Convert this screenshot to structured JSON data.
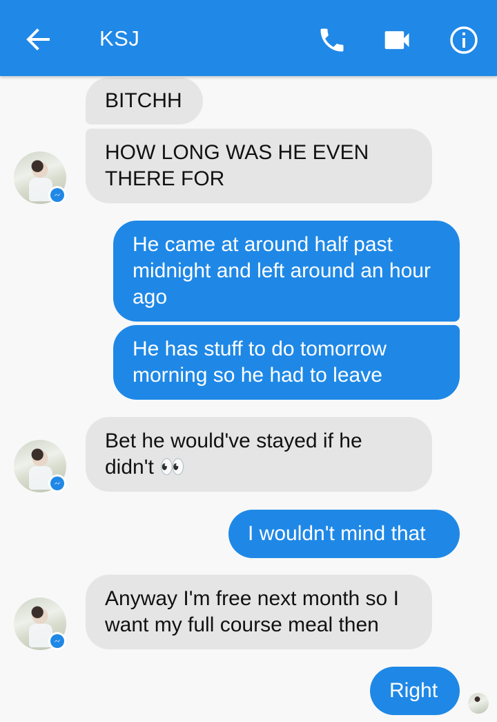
{
  "header": {
    "title": "KSJ"
  },
  "messages": [
    {
      "text": "BITCHH"
    },
    {
      "text": "HOW LONG WAS HE EVEN THERE FOR"
    },
    {
      "text": "He came at around half past midnight and left around an hour ago"
    },
    {
      "text": "He has stuff to do tomorrow morning so he had to leave"
    },
    {
      "text": "Bet he would've stayed if he didn't 👀"
    },
    {
      "text": "I wouldn't mind that"
    },
    {
      "text": "Anyway I'm free next month so I want my full course meal then"
    },
    {
      "text": "Right"
    }
  ],
  "colors": {
    "header": "#2088e6",
    "outgoing_bubble": "#1f88e6",
    "incoming_bubble": "#e5e5e5",
    "background": "#f8f8f8"
  },
  "icons": [
    "back-arrow-icon",
    "phone-icon",
    "video-camera-icon",
    "info-icon",
    "messenger-badge-icon"
  ]
}
